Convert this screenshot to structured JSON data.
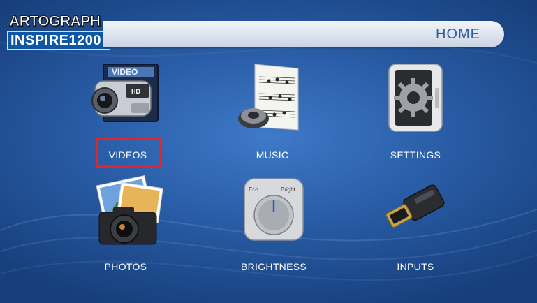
{
  "logo": {
    "brand": "ARTOGRAPH",
    "model": "INSPIRE1200"
  },
  "header": {
    "title": "HOME"
  },
  "menu": {
    "items": [
      {
        "label": "VIDEOS",
        "icon": "video-camera-icon",
        "selected": true
      },
      {
        "label": "MUSIC",
        "icon": "music-icon",
        "selected": false
      },
      {
        "label": "SETTINGS",
        "icon": "settings-icon",
        "selected": false
      },
      {
        "label": "PHOTOS",
        "icon": "photos-icon",
        "selected": false
      },
      {
        "label": "BRIGHTNESS",
        "icon": "brightness-icon",
        "selected": false
      },
      {
        "label": "INPUTS",
        "icon": "hdmi-input-icon",
        "selected": false
      }
    ],
    "brightness_scale": {
      "low": "Eco",
      "high": "Bright"
    }
  },
  "colors": {
    "background": "#2a5ea8",
    "header_text": "#2f5f9b",
    "selection": "#e0262b"
  }
}
